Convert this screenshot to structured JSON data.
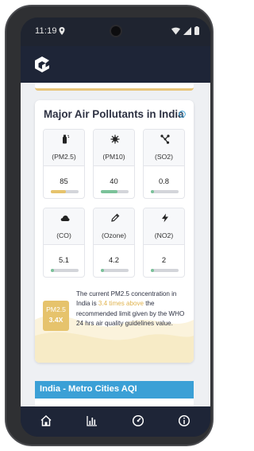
{
  "status_bar": {
    "time": "11:19",
    "icons": [
      "location-icon",
      "wifi-icon",
      "signal-icon",
      "battery-icon"
    ]
  },
  "app_bar": {
    "logo_icon": "cube-logo-icon"
  },
  "colors": {
    "app_bar": "#1e2537",
    "page_background": "#eef0f3",
    "highlight": "#e0b34e",
    "badge": "#e6c36c",
    "section_banner": "#3ba0d6"
  },
  "pollutants_card": {
    "title": "Major Air Pollutants in India",
    "items": [
      {
        "name": "(PM2.5)",
        "value": "85",
        "icon": "spray-icon",
        "level": 0.55,
        "bar_color": "#e6c36c"
      },
      {
        "name": "(PM10)",
        "value": "40",
        "icon": "virus-icon",
        "level": 0.6,
        "bar_color": "#7bc29a"
      },
      {
        "name": "(SO2)",
        "value": "0.8",
        "icon": "molecule-icon",
        "level": 0.12,
        "bar_color": "#7bc29a"
      },
      {
        "name": "(CO)",
        "value": "5.1",
        "icon": "cloud-icon",
        "level": 0.12,
        "bar_color": "#7bc29a"
      },
      {
        "name": "(Ozone)",
        "value": "4.2",
        "icon": "pencil-icon",
        "level": 0.12,
        "bar_color": "#7bc29a"
      },
      {
        "name": "(NO2)",
        "value": "2",
        "icon": "bolt-icon",
        "level": 0.12,
        "bar_color": "#7bc29a"
      }
    ],
    "badge": {
      "line1": "PM2.5",
      "line2": "3.4X"
    },
    "note": {
      "before": "The current PM2.5 concentration in India is ",
      "highlight": "3.4 times above",
      "after": " the recommended limit given by the WHO 24 hrs air quality guidelines value."
    }
  },
  "metro_section": {
    "title": "India - Metro Cities AQI"
  },
  "bottom_nav": {
    "items": [
      {
        "icon": "home-icon"
      },
      {
        "icon": "chart-icon"
      },
      {
        "icon": "gauge-icon"
      },
      {
        "icon": "info-icon"
      }
    ]
  }
}
